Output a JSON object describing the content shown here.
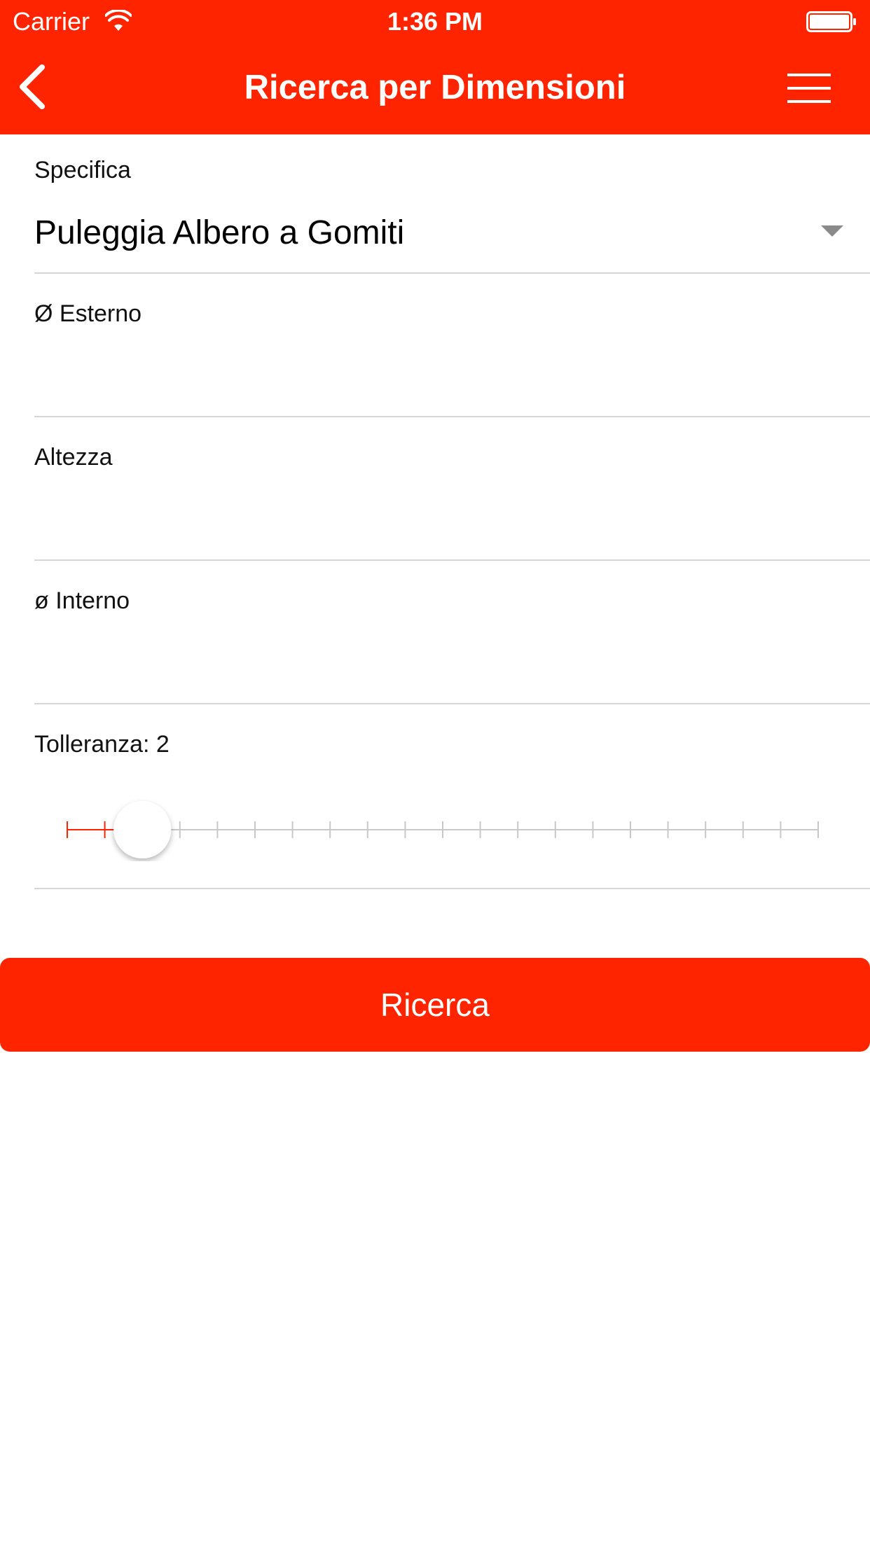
{
  "status_bar": {
    "carrier": "Carrier",
    "time": "1:36 PM"
  },
  "nav": {
    "title": "Ricerca per Dimensioni",
    "back_icon": "chevron-left-icon",
    "menu_icon": "hamburger-menu-icon"
  },
  "form": {
    "specifica": {
      "label": "Specifica",
      "value": "Puleggia Albero a Gomiti"
    },
    "esterno": {
      "label": "Ø Esterno",
      "value": ""
    },
    "altezza": {
      "label": "Altezza",
      "value": ""
    },
    "interno": {
      "label": "ø Interno",
      "value": ""
    },
    "tolleranza": {
      "label": "Tolleranza: 2",
      "value": 2,
      "min": 0,
      "max": 20,
      "step": 1
    }
  },
  "search_button": {
    "label": "Ricerca"
  },
  "colors": {
    "accent": "#ff2400",
    "track": "#c8c8c8",
    "divider": "#d6d6d6"
  }
}
